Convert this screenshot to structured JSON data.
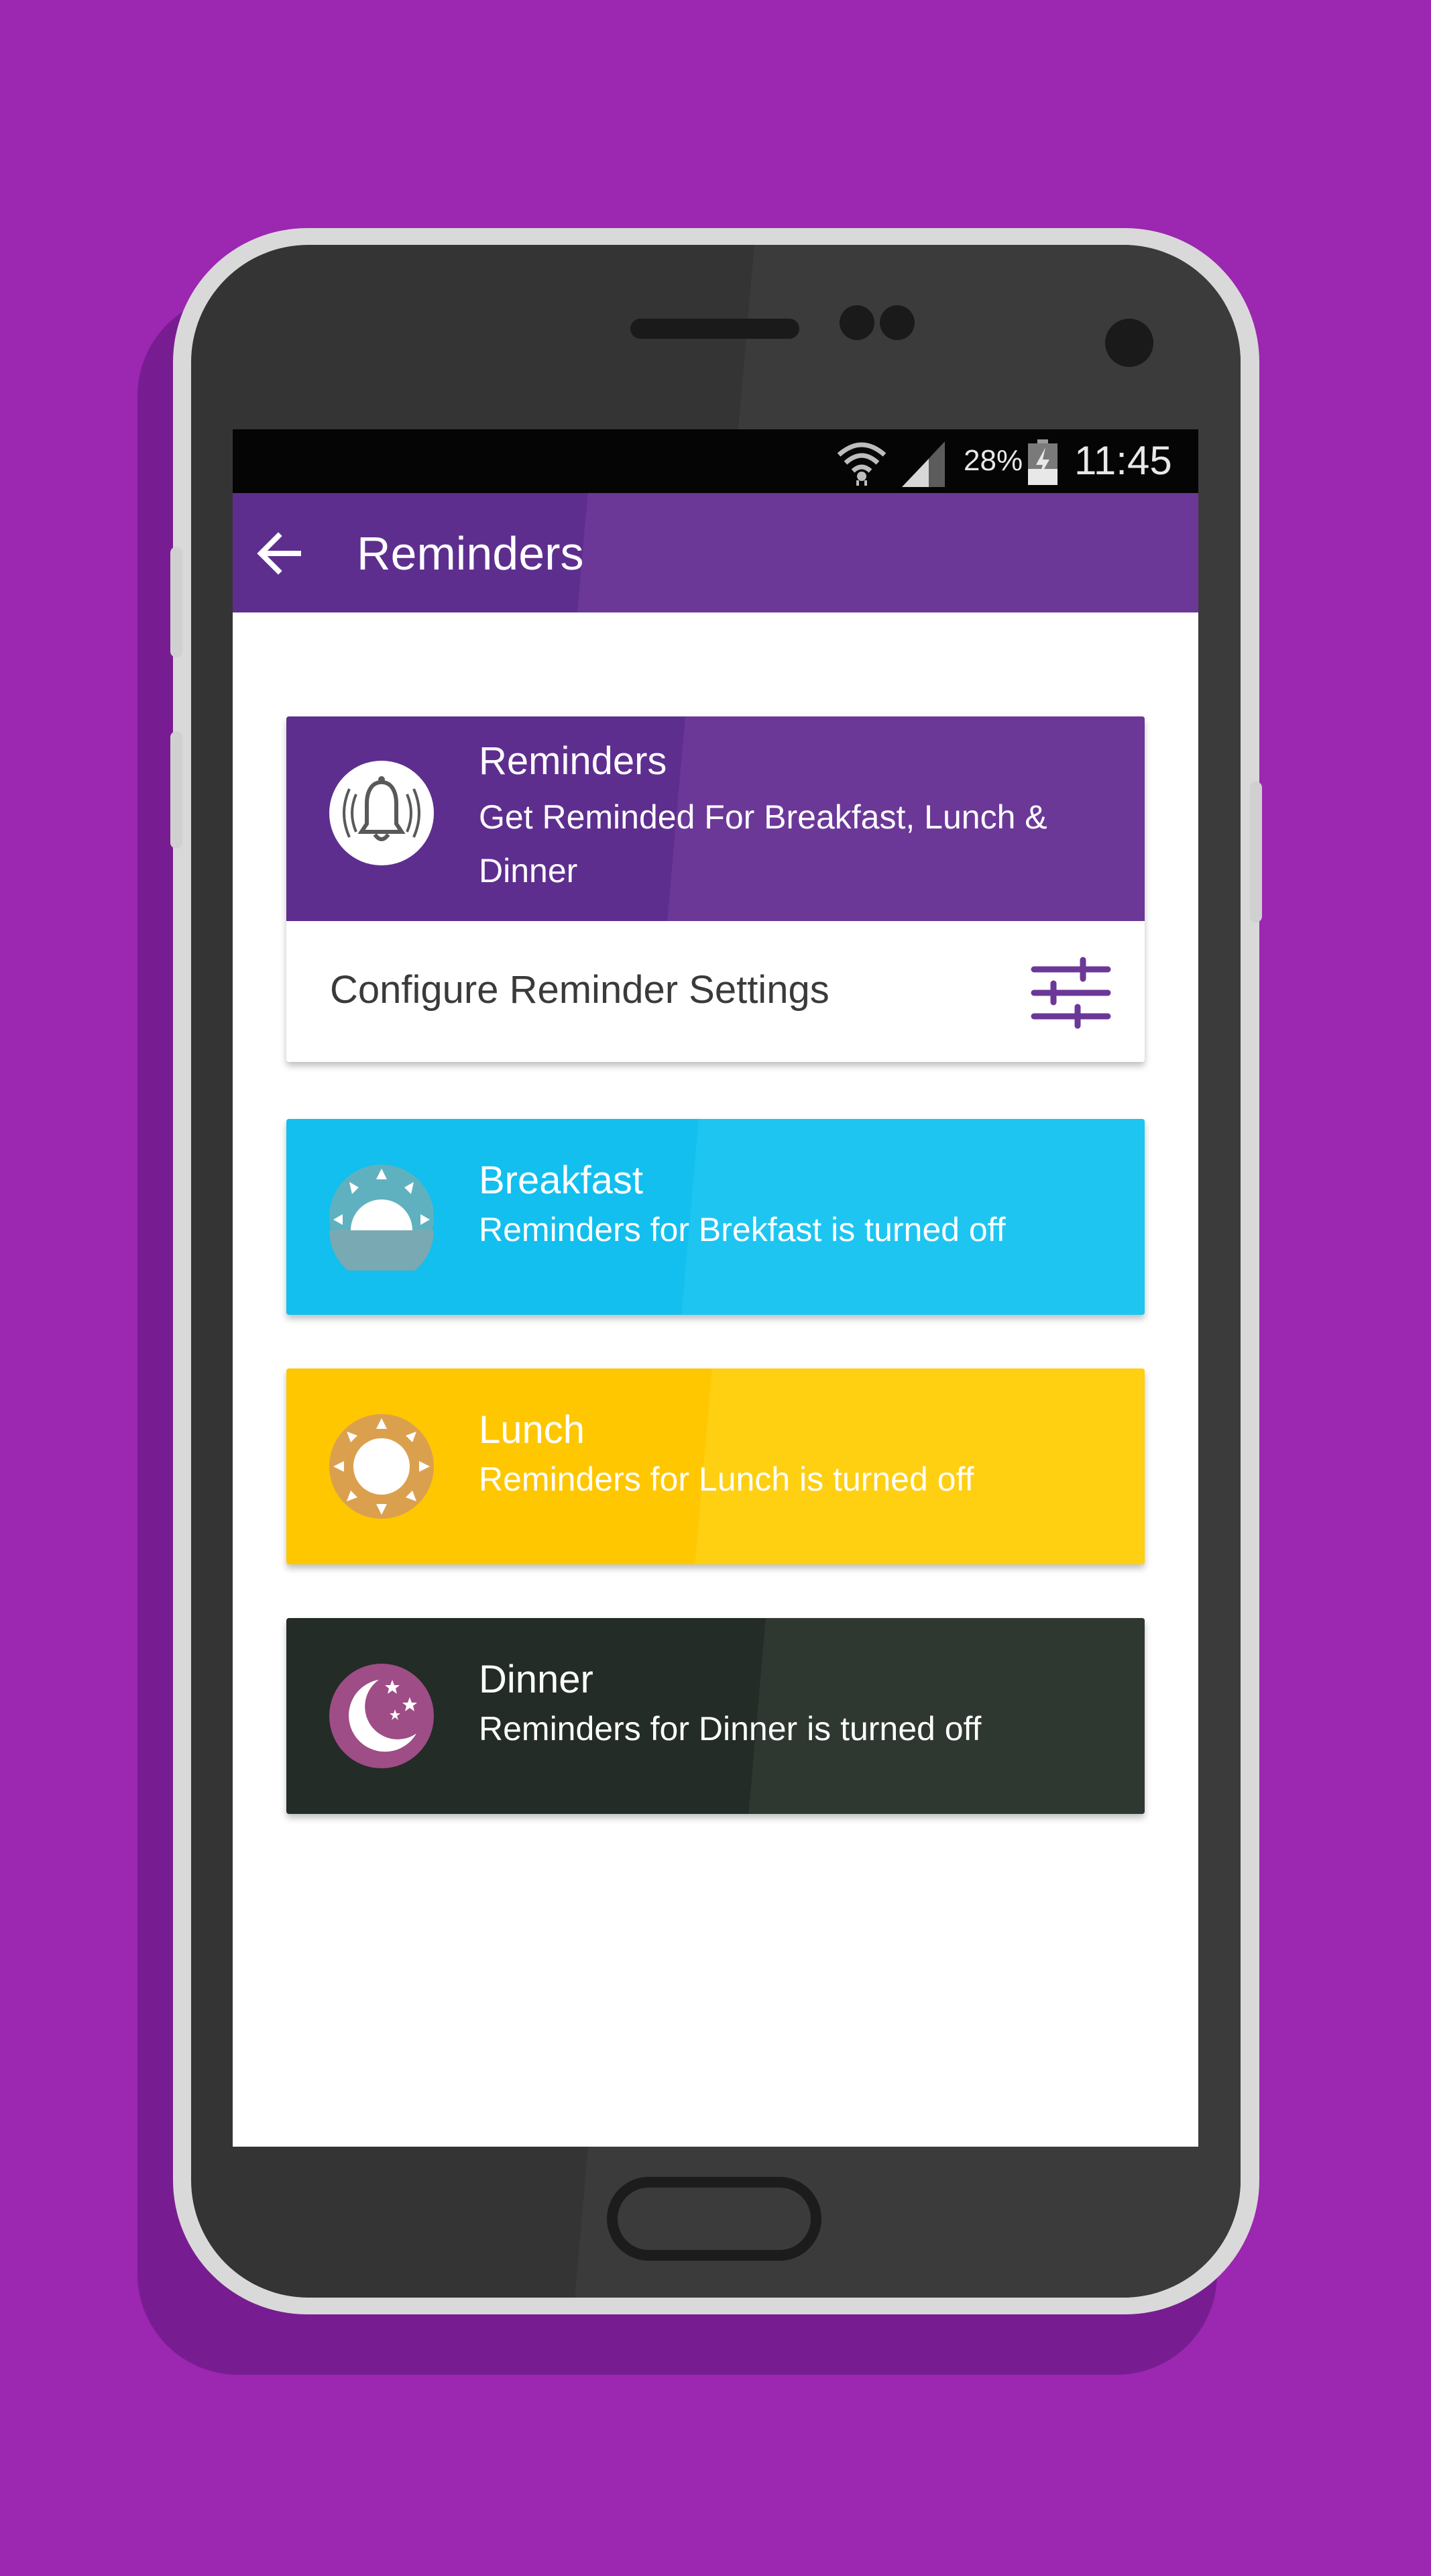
{
  "status_bar": {
    "battery_percent": "28%",
    "time": "11:45"
  },
  "app_bar": {
    "title": "Reminders"
  },
  "reminders_card": {
    "title": "Reminders",
    "subtitle": "Get Reminded For Breakfast, Lunch & Dinner",
    "icon": "bell-icon",
    "config_label": "Configure Reminder Settings",
    "config_icon": "tune-sliders-icon"
  },
  "meals": [
    {
      "title": "Breakfast",
      "subtitle": "Reminders for Brekfast is turned off",
      "icon": "sunrise-icon",
      "color": "#12bfee"
    },
    {
      "title": "Lunch",
      "subtitle": "Reminders for Lunch is turned off",
      "icon": "sun-icon",
      "color": "#ffc700"
    },
    {
      "title": "Dinner",
      "subtitle": "Reminders for Dinner is turned off",
      "icon": "moon-icon",
      "color": "#232c26"
    }
  ],
  "colors": {
    "background": "#9c27b0",
    "primary": "#5e2e8f",
    "accent": "#6b3898"
  }
}
